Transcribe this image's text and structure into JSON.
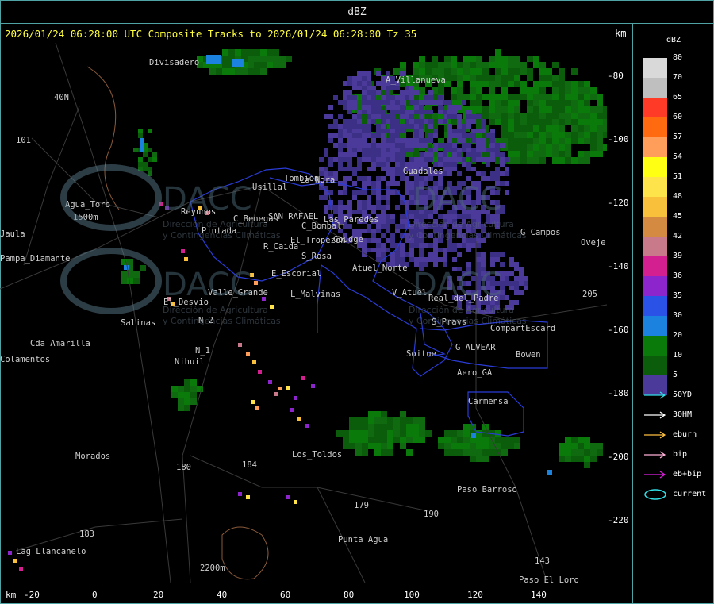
{
  "window": {
    "title": "dBZ"
  },
  "header": {
    "text": "2026/01/24 06:28:00 UTC Composite Tracks to 2026/01/24 06:28:00 Tz 35",
    "km_top": "km",
    "km_bottom": "km"
  },
  "axes": {
    "x_ticks": [
      "-20",
      "0",
      "20",
      "40",
      "60",
      "80",
      "100",
      "120",
      "140"
    ],
    "y_ticks": [
      "-80",
      "-100",
      "-120",
      "-140",
      "-160",
      "-180",
      "-200",
      "-220"
    ]
  },
  "legend": {
    "unit": "dBZ",
    "levels": [
      {
        "value": "80",
        "color": "#d9d9d9"
      },
      {
        "value": "70",
        "color": "#bfbfbf"
      },
      {
        "value": "65",
        "color": "#ff3a26"
      },
      {
        "value": "60",
        "color": "#ff6a10"
      },
      {
        "value": "57",
        "color": "#ff9d5a"
      },
      {
        "value": "54",
        "color": "#ffff14"
      },
      {
        "value": "51",
        "color": "#ffe34a"
      },
      {
        "value": "48",
        "color": "#f9c03c"
      },
      {
        "value": "45",
        "color": "#d48a40"
      },
      {
        "value": "42",
        "color": "#c97a8a"
      },
      {
        "value": "39",
        "color": "#d41f90"
      },
      {
        "value": "36",
        "color": "#8c26cc"
      },
      {
        "value": "35",
        "color": "#2a52e6"
      },
      {
        "value": "30",
        "color": "#1b82e0"
      },
      {
        "value": "20",
        "color": "#0a7a0a"
      },
      {
        "value": "10",
        "color": "#0b5c0b"
      },
      {
        "value": "5",
        "color": "#4b3a9a"
      }
    ],
    "tracks": [
      {
        "label": "50YD",
        "color": "#32e0e8"
      },
      {
        "label": "30HM",
        "color": "#ffffff"
      },
      {
        "label": "eburn",
        "color": "#ffc040"
      },
      {
        "label": "bip",
        "color": "#ffb0d8"
      },
      {
        "label": "eb+bip",
        "color": "#e020e0"
      },
      {
        "label": "current",
        "color": "#32e0e8"
      }
    ]
  },
  "places": [
    {
      "name": "Divisadero"
    },
    {
      "name": "A_Villanueva"
    },
    {
      "name": "40N"
    },
    {
      "name": "101"
    },
    {
      "name": "Agua_Toro"
    },
    {
      "name": "1500m"
    },
    {
      "name": "Jaula"
    },
    {
      "name": "Pampa_Diamante"
    },
    {
      "name": "Usillal"
    },
    {
      "name": "Tombion"
    },
    {
      "name": "La_Nora"
    },
    {
      "name": "Guadales"
    },
    {
      "name": "Reyunos"
    },
    {
      "name": "C_Benegas"
    },
    {
      "name": "SAN_RAFAEL"
    },
    {
      "name": "Las_Paredes"
    },
    {
      "name": "C_Bombal"
    },
    {
      "name": "Pintada"
    },
    {
      "name": "El_Tropezón"
    },
    {
      "name": "Goudge"
    },
    {
      "name": "R_Caida"
    },
    {
      "name": "S_Rosa"
    },
    {
      "name": "Atuel_Norte"
    },
    {
      "name": "G_Campos"
    },
    {
      "name": "Ovejería"
    },
    {
      "name": "E_Escorial"
    },
    {
      "name": "L_Malvinas"
    },
    {
      "name": "V_Atuel"
    },
    {
      "name": "Real_del_Padre"
    },
    {
      "name": "Valle_Grande"
    },
    {
      "name": "El_Desvio"
    },
    {
      "name": "Salinas"
    },
    {
      "name": "N_2"
    },
    {
      "name": "N_1"
    },
    {
      "name": "Nihuil"
    },
    {
      "name": "S_Pravs"
    },
    {
      "name": "CompartEscard"
    },
    {
      "name": "G_ALVEAR"
    },
    {
      "name": "Soitue"
    },
    {
      "name": "Bowen"
    },
    {
      "name": "Aero_GA"
    },
    {
      "name": "Cda_Amarilla"
    },
    {
      "name": "Colamentos"
    },
    {
      "name": "Carmensa"
    },
    {
      "name": "Morados"
    },
    {
      "name": "Los_Toldos"
    },
    {
      "name": "180"
    },
    {
      "name": "184"
    },
    {
      "name": "179"
    },
    {
      "name": "190"
    },
    {
      "name": "Paso_Barroso"
    },
    {
      "name": "183"
    },
    {
      "name": "Lag_Llancanelo"
    },
    {
      "name": "Punta_Agua"
    },
    {
      "name": "2200m"
    },
    {
      "name": "143"
    },
    {
      "name": "Paso_El_Loro"
    },
    {
      "name": "205"
    }
  ],
  "watermark": {
    "org": "DACC",
    "line1": "Dirección de Agricultura",
    "line2": "y Contingencias Climáticas"
  }
}
